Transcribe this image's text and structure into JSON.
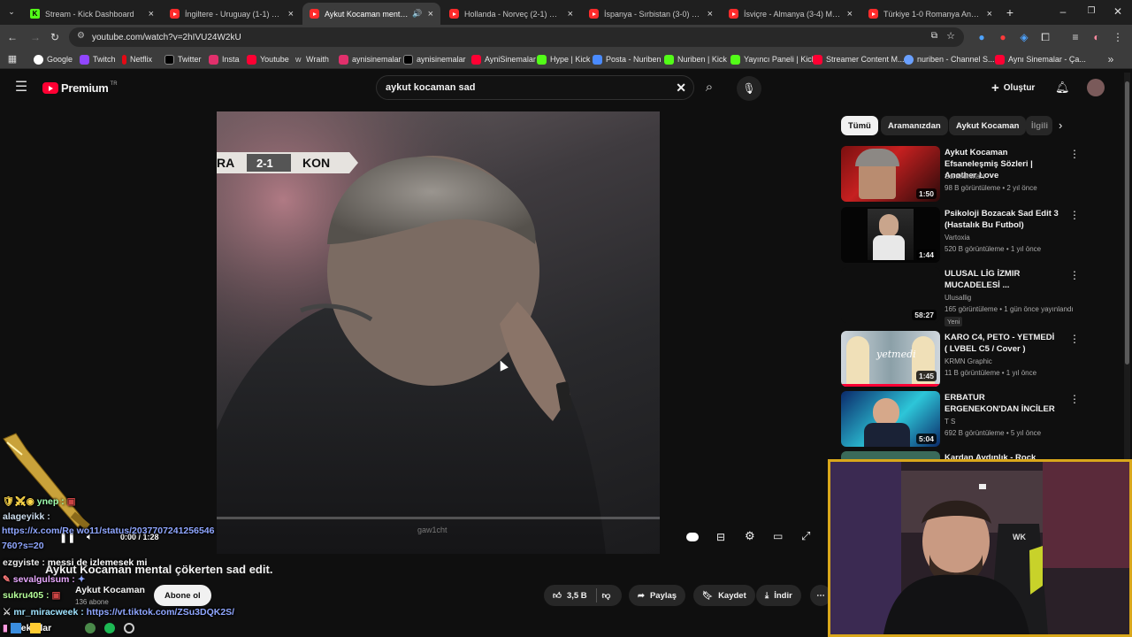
{
  "tabs": [
    {
      "title": "Stream - Kick Dashboard",
      "icon": "kick"
    },
    {
      "title": "İngiltere - Uruguay (1-1) Maç Ö",
      "icon": "youtube"
    },
    {
      "title": "Aykut Kocaman mental çök",
      "icon": "youtube",
      "active": true
    },
    {
      "title": "Hollanda - Norveç (2-1) Maç Ö",
      "icon": "youtube"
    },
    {
      "title": "İspanya - Sırbistan (3-0) Maç Ö",
      "icon": "youtube"
    },
    {
      "title": "İsviçre - Almanya (3-4) Maç Öz",
      "icon": "youtube"
    },
    {
      "title": "Türkiye 1-0 Romanya Analizi -",
      "icon": "youtube"
    }
  ],
  "url": "youtube.com/watch?v=2hIVU24W2kU",
  "bookmarks": [
    "Google",
    "Twitch",
    "Netflix",
    "Twitter",
    "Insta",
    "Youtube",
    "Wraith",
    "aynisinemalar",
    "aynisinemalar",
    "AyniSinemalar",
    "Hype | Kick",
    "Posta - Nuriben",
    "Nuriben | Kick",
    "Yayıncı Paneli | Kick",
    "Streamer Content M...",
    "nuriben - Channel S...",
    "Aynı Sinemalar - Ça..."
  ],
  "yt": {
    "logo": "Premium",
    "logo_sup": "TR",
    "search_value": "aykut kocaman sad",
    "create_label": "Oluştur"
  },
  "video": {
    "score_left": "RA",
    "score": "2-1",
    "score_right": "KON",
    "watermark": "gaw1cht",
    "time": "0:00 / 1:28",
    "progress": 0.0,
    "title": "Aykut Kocaman mental çökerten sad edit.",
    "channel": "Aykut Kocaman",
    "subscribers": "136 abone",
    "subscribe_label": "Abone ol",
    "likes": "3,5 B",
    "share_label": "Paylaş",
    "save_label": "Kaydet",
    "download_label": "İndir"
  },
  "chips": [
    "Tümü",
    "Aramanızdan",
    "Aykut Kocaman",
    "İlgili"
  ],
  "recommendations": [
    {
      "title": "Aykut Kocaman Efsaneleşmiş Sözleri | Another Love",
      "channel": "SonMohikaN",
      "meta": "98 B görüntüleme • 2 yıl önce",
      "duration": "1:50",
      "thumb": "a"
    },
    {
      "title": "Psikoloji Bozacak Sad Edit 3 (Hastalık Bu Futbol)",
      "channel": "Vartoxia",
      "meta": "520 B görüntüleme • 1 yıl önce",
      "duration": "1:44",
      "thumb": "b"
    },
    {
      "title": "ULUSAL LİG İZMIR MUCADELESİ ...",
      "channel": "Ulusallig",
      "meta": "165 görüntüleme • 1 gün önce yayınlandı",
      "duration": "58:27",
      "badge": "Yeni",
      "thumb": "c"
    },
    {
      "title": "KARO C4, PETO - YETMEDİ ( LVBEL C5 / Cover )",
      "channel": "KRMN Graphic",
      "meta": "11 B görüntüleme • 1 yıl önce",
      "duration": "1:45",
      "thumb": "d"
    },
    {
      "title": "ERBATUR ERGENEKON'DAN İNCİLER",
      "channel": "T S",
      "meta": "692 B görüntüleme • 5 yıl önce",
      "duration": "5:04",
      "thumb": "e"
    },
    {
      "title": "Kardan Aydınlık - Rock Cover",
      "channel": "",
      "meta": "",
      "duration": "",
      "thumb": "f"
    }
  ],
  "chat": [
    {
      "user": "",
      "msg": "ynep :"
    },
    {
      "user": "alageyikk :",
      "msg": ""
    },
    {
      "user": "",
      "msg": "https://x.com/Re        wo11/status/2037707241256546"
    },
    {
      "user": "",
      "msg": "760?s=20"
    },
    {
      "user": "ezgyiste :",
      "msg": "messi de izlemesek mi"
    },
    {
      "user": "sevalgulsum :",
      "msg": ""
    },
    {
      "user": "sukru405 :",
      "msg": ""
    },
    {
      "user": "mr_miracweek :",
      "msg": "https://vt.tiktok.com/ZSu3DQK2S/"
    },
    {
      "user": "",
      "msg": ": Tekrslar"
    }
  ],
  "colors": {
    "accent": "#ff0033",
    "chat_link": "#8fa6ff",
    "chat_user": "#ffffff",
    "webcam_border": "#d9a71b"
  }
}
